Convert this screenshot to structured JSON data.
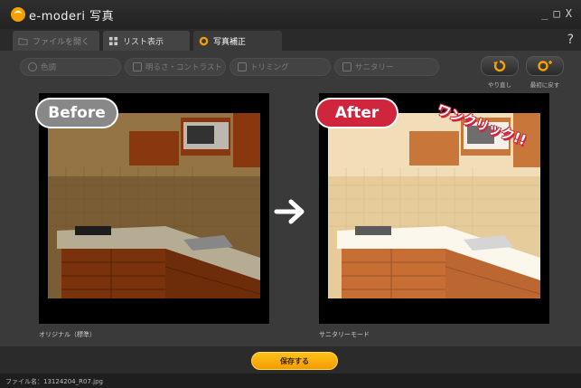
{
  "app": {
    "title": "e-moderi 写真",
    "window_controls": [
      "_",
      "□",
      "X"
    ]
  },
  "tabs": [
    {
      "label": "ファイルを開く",
      "icon": "folder-icon",
      "active": false
    },
    {
      "label": "リスト表示",
      "icon": "grid-icon",
      "active": false
    },
    {
      "label": "写真補正",
      "icon": "gear-icon",
      "active": true
    }
  ],
  "help_label": "?",
  "tools": [
    {
      "label": "色調",
      "icon": "palette-icon"
    },
    {
      "label": "明るさ・コントラスト",
      "icon": "brightness-icon"
    },
    {
      "label": "トリミング",
      "icon": "crop-icon"
    },
    {
      "label": "サニタリー",
      "icon": "sanitary-icon"
    }
  ],
  "actions": {
    "undo_label": "やり直し",
    "redo_label": "最初に戻す",
    "undo_icon": "undo-icon",
    "redo_icon": "reset-icon"
  },
  "before": {
    "badge": "Before",
    "caption": "オリジナル（標準）"
  },
  "after": {
    "badge": "After",
    "caption": "サニタリーモード"
  },
  "callout": "ワンクリック!!",
  "save_label": "保存する",
  "status": "ファイル名：13124204_R07.jpg",
  "colors": {
    "accent": "#f5a200",
    "before_badge": "#888888",
    "after_badge": "#d0263d"
  }
}
